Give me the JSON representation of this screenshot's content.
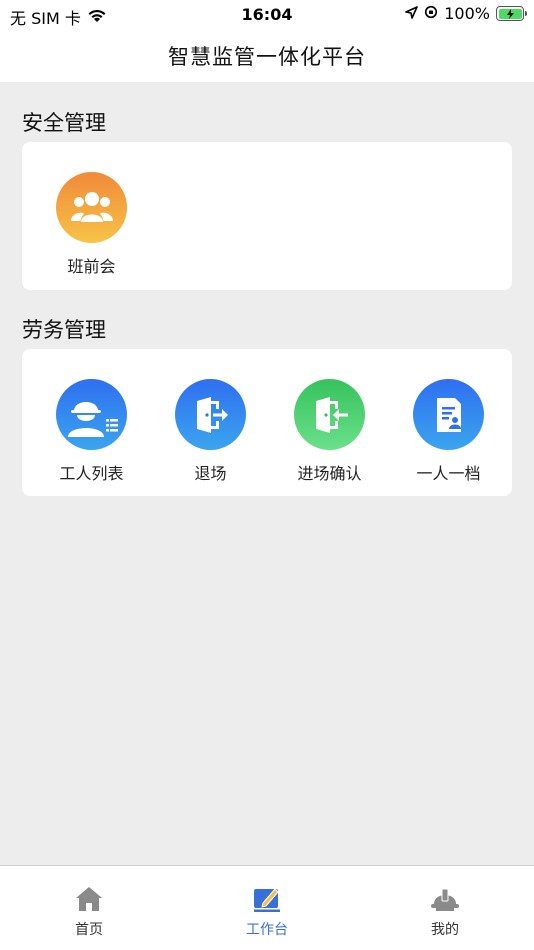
{
  "status_bar": {
    "carrier": "无 SIM 卡",
    "time": "16:04",
    "battery": "100%"
  },
  "nav": {
    "title": "智慧监管一体化平台"
  },
  "sections": [
    {
      "title": "安全管理",
      "items": [
        {
          "label": "班前会",
          "icon": "group-people-icon"
        }
      ]
    },
    {
      "title": "劳务管理",
      "items": [
        {
          "label": "工人列表",
          "icon": "worker-list-icon"
        },
        {
          "label": "退场",
          "icon": "exit-door-icon"
        },
        {
          "label": "进场确认",
          "icon": "enter-door-icon"
        },
        {
          "label": "一人一档",
          "icon": "person-file-icon"
        }
      ]
    }
  ],
  "tab_bar": {
    "tabs": [
      {
        "label": "首页",
        "icon": "home-icon",
        "active": false
      },
      {
        "label": "工作台",
        "icon": "workbench-icon",
        "active": true
      },
      {
        "label": "我的",
        "icon": "helmet-icon",
        "active": false
      }
    ]
  },
  "colors": {
    "accent": "#3a6fd8",
    "background": "#ededed",
    "orange": "#f08a3a",
    "blue": "#2f6ff0",
    "green": "#36c25d"
  }
}
